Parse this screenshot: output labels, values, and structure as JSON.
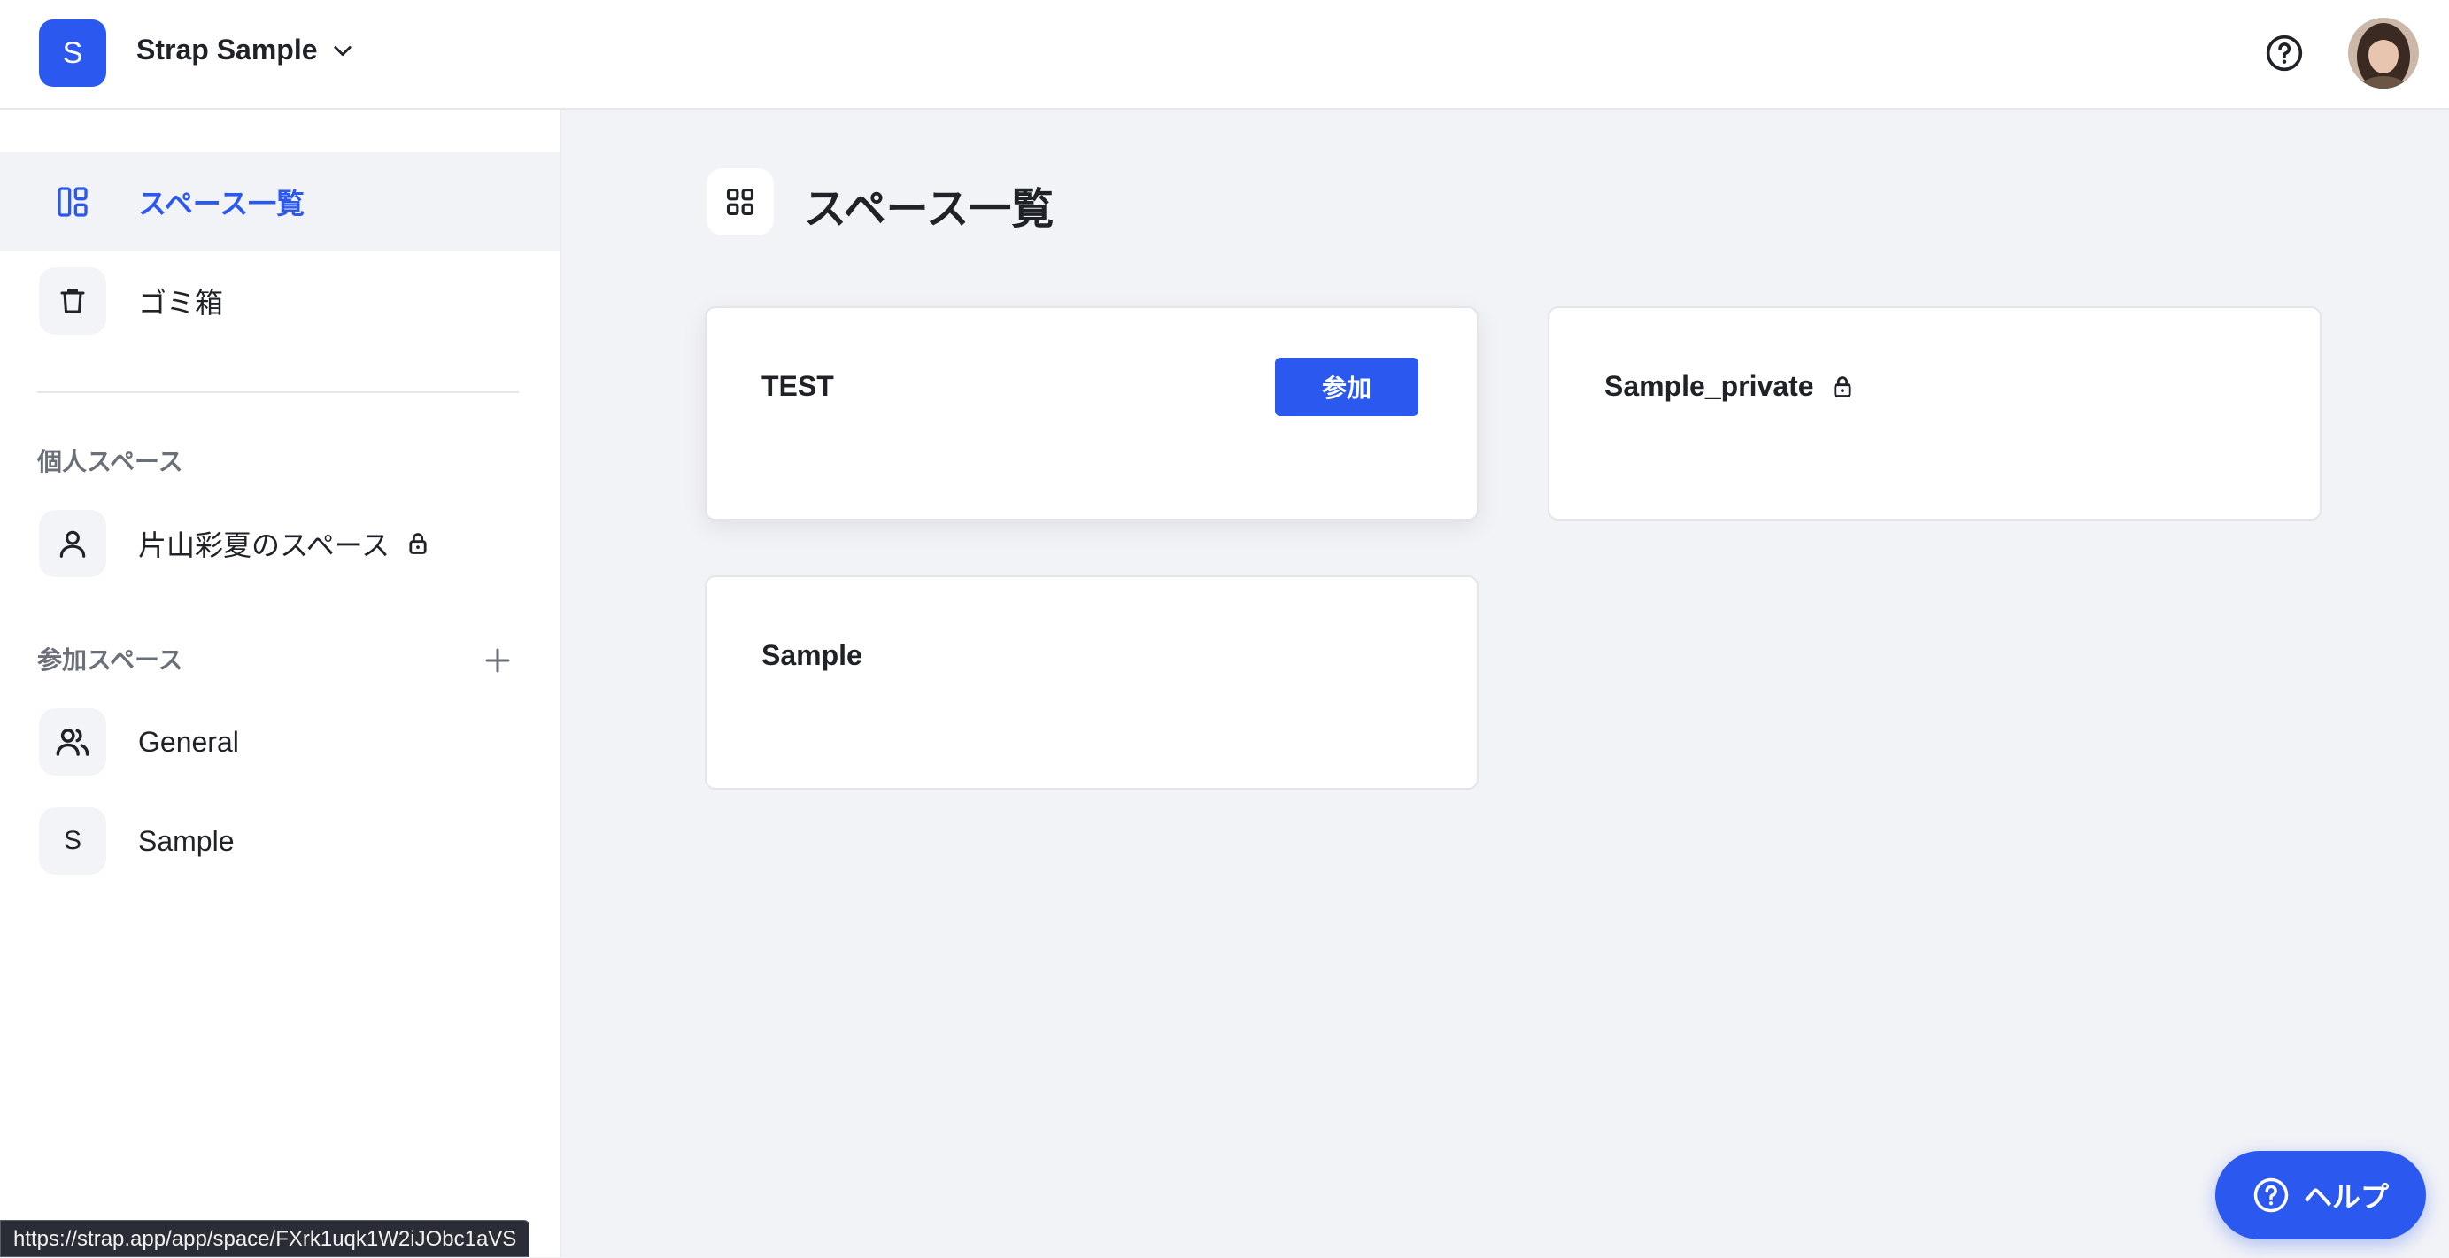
{
  "header": {
    "workspace_initial": "S",
    "workspace_name": "Strap Sample"
  },
  "sidebar": {
    "nav": [
      {
        "label": "スペース一覧",
        "icon": "spaces-icon",
        "active": true
      },
      {
        "label": "ゴミ箱",
        "icon": "trash-icon",
        "active": false
      }
    ],
    "personal_section_title": "個人スペース",
    "personal_spaces": [
      {
        "label": "片山彩夏のスペース",
        "icon": "person-icon",
        "locked": true
      }
    ],
    "joined_section_title": "参加スペース",
    "joined_spaces": [
      {
        "label": "General",
        "icon": "people-icon"
      },
      {
        "label": "Sample",
        "icon_text": "S"
      }
    ]
  },
  "main": {
    "title": "スペース一覧",
    "cards": [
      {
        "title": "TEST",
        "action_label": "参加"
      },
      {
        "title": "Sample_private",
        "locked": true
      },
      {
        "title": "Sample"
      }
    ]
  },
  "help_button": {
    "label": "ヘルプ"
  },
  "status_url": "https://strap.app/app/space/FXrk1uqk1W2iJObc1aVS",
  "colors": {
    "accent": "#2b59f0",
    "background": "#f2f3f7"
  }
}
